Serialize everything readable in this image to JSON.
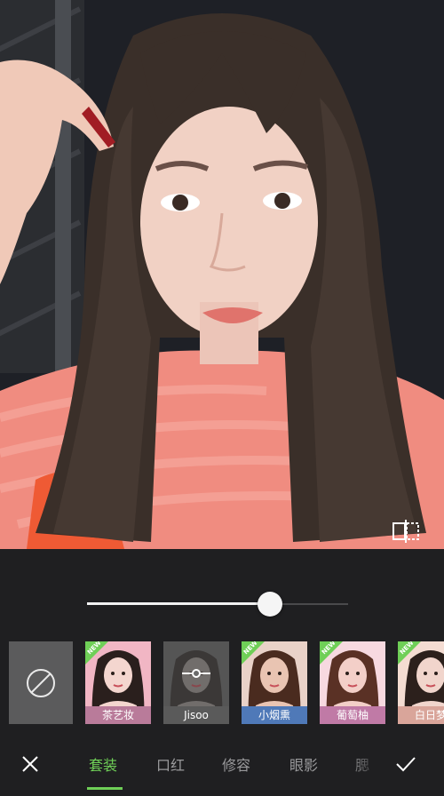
{
  "slider": {
    "value": 0.7
  },
  "looks": [
    {
      "label": "茶艺妆",
      "badge": "NEW",
      "selected": false,
      "bg": "#f1b6c4",
      "label_bg": "#b97b9a",
      "hair": "#2a1f1d",
      "skin": "#f4d6cf"
    },
    {
      "label": "Jisoo",
      "badge": "",
      "selected": true,
      "bg": "#6b6b6b",
      "label_bg": "#5a5a5a",
      "hair": "#3b3634",
      "skin": "#9d9693"
    },
    {
      "label": "小烟熏",
      "badge": "NEW",
      "selected": false,
      "bg": "#e9d2c8",
      "label_bg": "#4f79b8",
      "hair": "#4a2b1f",
      "skin": "#e9c4b2"
    },
    {
      "label": "葡萄柚",
      "badge": "NEW",
      "selected": false,
      "bg": "#f7d9e0",
      "label_bg": "#c07aa6",
      "hair": "#5a3125",
      "skin": "#f3cfc8"
    },
    {
      "label": "白日梦",
      "badge": "NEW",
      "selected": false,
      "bg": "#f4dcd2",
      "label_bg": "#d9a59a",
      "hair": "#2c201c",
      "skin": "#f1d5cc"
    }
  ],
  "tabs": [
    {
      "label": "套装",
      "active": true
    },
    {
      "label": "口红",
      "active": false
    },
    {
      "label": "修容",
      "active": false
    },
    {
      "label": "眼影",
      "active": false
    },
    {
      "label": "腮",
      "active": false
    }
  ],
  "colors": {
    "accent": "#6fcf57",
    "panel": "#1f1f21"
  },
  "icons": {
    "none": "no-filter-icon",
    "close": "close-icon",
    "confirm": "check-icon",
    "compare": "compare-icon"
  }
}
